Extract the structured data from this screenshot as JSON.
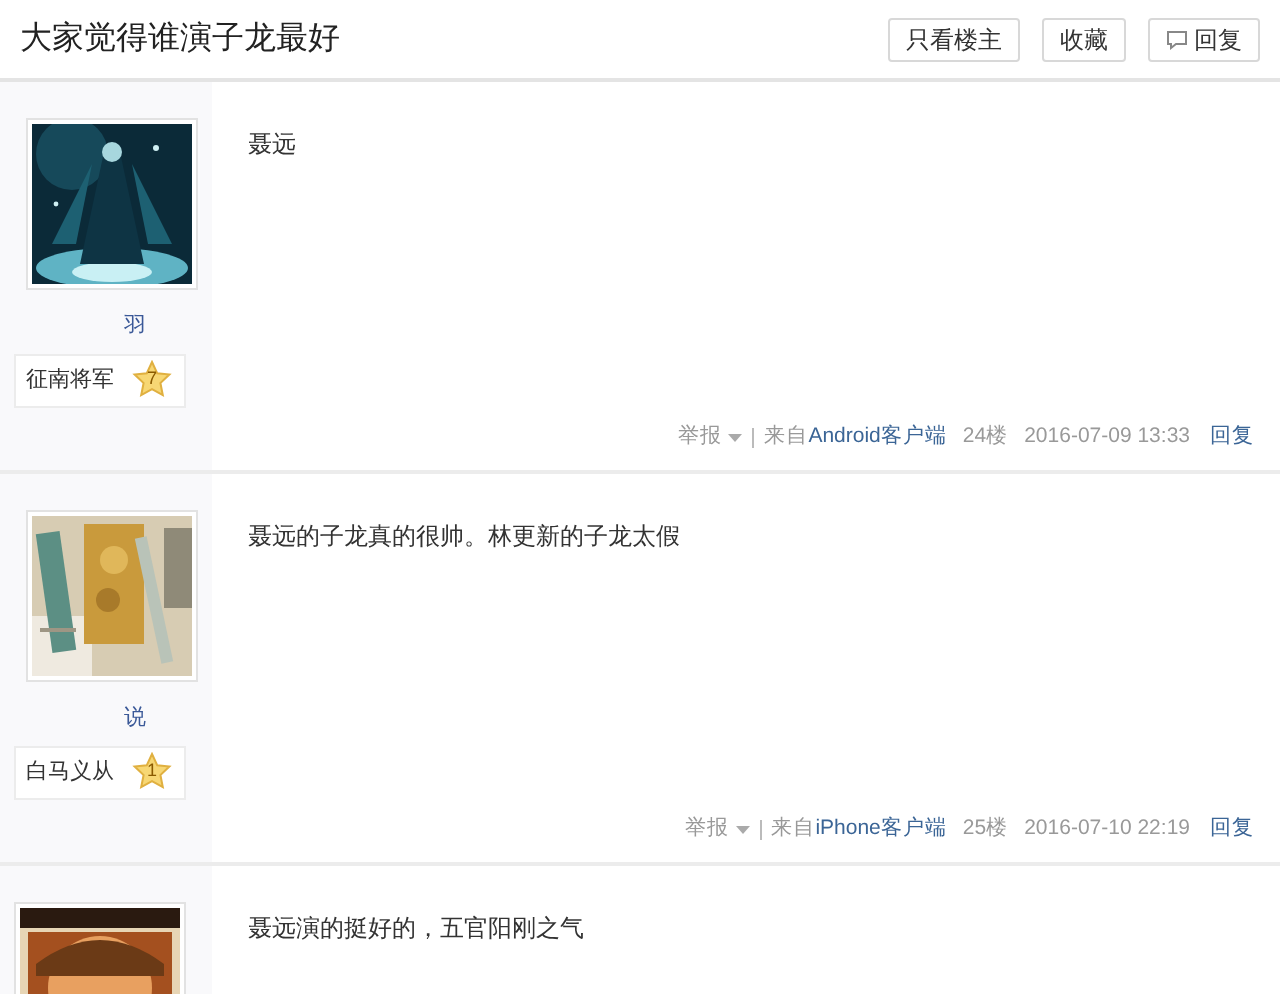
{
  "thread": {
    "title": "大家觉得谁演子龙最好"
  },
  "buttons": [
    {
      "label": "只看楼主"
    },
    {
      "label": "收藏"
    },
    {
      "label": "回复",
      "kind": "reply"
    }
  ],
  "posts": [
    {
      "username": "羽",
      "rank": {
        "title": "征南将军",
        "level": "7"
      },
      "content": "聂远",
      "footer": {
        "report": "举报",
        "source_prefix": "来自",
        "source": "Android客户端",
        "floor": "24楼",
        "time": "2016-07-09 13:33",
        "reply": "回复"
      }
    },
    {
      "username": "说",
      "rank": {
        "title": "白马义从",
        "level": "1"
      },
      "content": "聂远的子龙真的很帅。林更新的子龙太假",
      "footer": {
        "report": "举报",
        "source_prefix": "来自",
        "source": "iPhone客户端",
        "floor": "25楼",
        "time": "2016-07-10 22:19",
        "reply": "回复"
      }
    },
    {
      "content": "聂远演的挺好的，五官阳刚之气"
    }
  ]
}
